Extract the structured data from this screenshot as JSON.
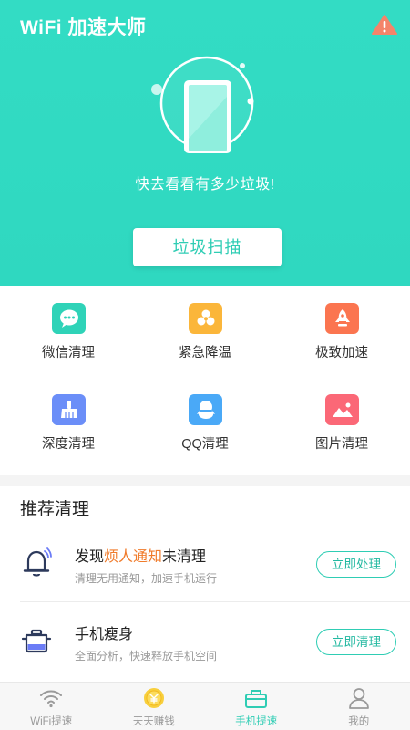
{
  "header": {
    "app_title": "WiFi 加速大师",
    "tagline": "快去看看有多少垃圾!",
    "scan_button": "垃圾扫描"
  },
  "tools": [
    {
      "label": "微信清理",
      "icon": "wechat-icon",
      "color": "#2fd3b8"
    },
    {
      "label": "紧急降温",
      "icon": "fan-icon",
      "color": "#fbb63a"
    },
    {
      "label": "极致加速",
      "icon": "rocket-icon",
      "color": "#fb7550"
    },
    {
      "label": "深度清理",
      "icon": "broom-icon",
      "color": "#6b8ef8"
    },
    {
      "label": "QQ清理",
      "icon": "qq-icon",
      "color": "#4aa9f7"
    },
    {
      "label": "图片清理",
      "icon": "image-icon",
      "color": "#fb6877"
    }
  ],
  "recommend": {
    "title": "推荐清理",
    "items": [
      {
        "title_pre": "发现",
        "title_highlight": "烦人通知",
        "title_post": "未清理",
        "subtitle": "清理无用通知，加速手机运行",
        "button": "立即处理",
        "icon": "bell-icon"
      },
      {
        "title_pre": "手机瘦身",
        "title_highlight": "",
        "title_post": "",
        "subtitle": "全面分析，快速释放手机空间",
        "button": "立即清理",
        "icon": "pot-icon"
      }
    ]
  },
  "tabbar": {
    "tabs": [
      {
        "label": "WiFi提速",
        "icon": "wifi-icon",
        "active": false
      },
      {
        "label": "天天赚钱",
        "icon": "coin-icon",
        "active": false
      },
      {
        "label": "手机提速",
        "icon": "toolbox-icon",
        "active": true
      },
      {
        "label": "我的",
        "icon": "user-icon",
        "active": false
      }
    ]
  },
  "colors": {
    "accent": "#2fd8c0",
    "highlight": "#f07b2b"
  }
}
